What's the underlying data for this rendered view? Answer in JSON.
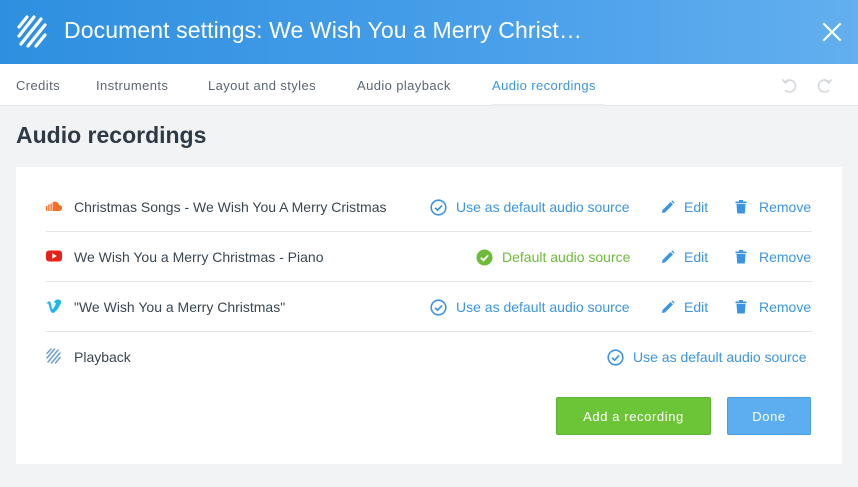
{
  "header": {
    "title": "Document settings: We Wish You a Merry Christmas"
  },
  "tabs": [
    {
      "label": "Credits"
    },
    {
      "label": "Instruments"
    },
    {
      "label": "Layout and styles"
    },
    {
      "label": "Audio playback"
    },
    {
      "label": "Audio recordings",
      "active": true
    }
  ],
  "page_title": "Audio recordings",
  "recordings": [
    {
      "source_icon": "soundcloud-icon",
      "title": "Christmas Songs - We Wish You A Merry Cristmas",
      "default_label": "Use as default audio source",
      "is_default": false,
      "edit": "Edit",
      "remove": "Remove"
    },
    {
      "source_icon": "youtube-icon",
      "title": "We Wish You a Merry Christmas - Piano",
      "default_label": "Default audio source",
      "is_default": true,
      "edit": "Edit",
      "remove": "Remove"
    },
    {
      "source_icon": "vimeo-icon",
      "title": "\"We Wish You a Merry Christmas\"",
      "default_label": "Use as default audio source",
      "is_default": false,
      "edit": "Edit",
      "remove": "Remove"
    },
    {
      "source_icon": "flat-logo-icon",
      "title": "Playback",
      "default_label": "Use as default audio source",
      "is_default": false
    }
  ],
  "buttons": {
    "add": "Add a recording",
    "done": "Done"
  },
  "colors": {
    "header_gradient_start": "#2e8fe0",
    "header_gradient_end": "#63afef",
    "accent_blue": "#3a95e4",
    "accent_green": "#6cbc38",
    "add_button": "#6cc437",
    "done_button": "#5caef0"
  }
}
